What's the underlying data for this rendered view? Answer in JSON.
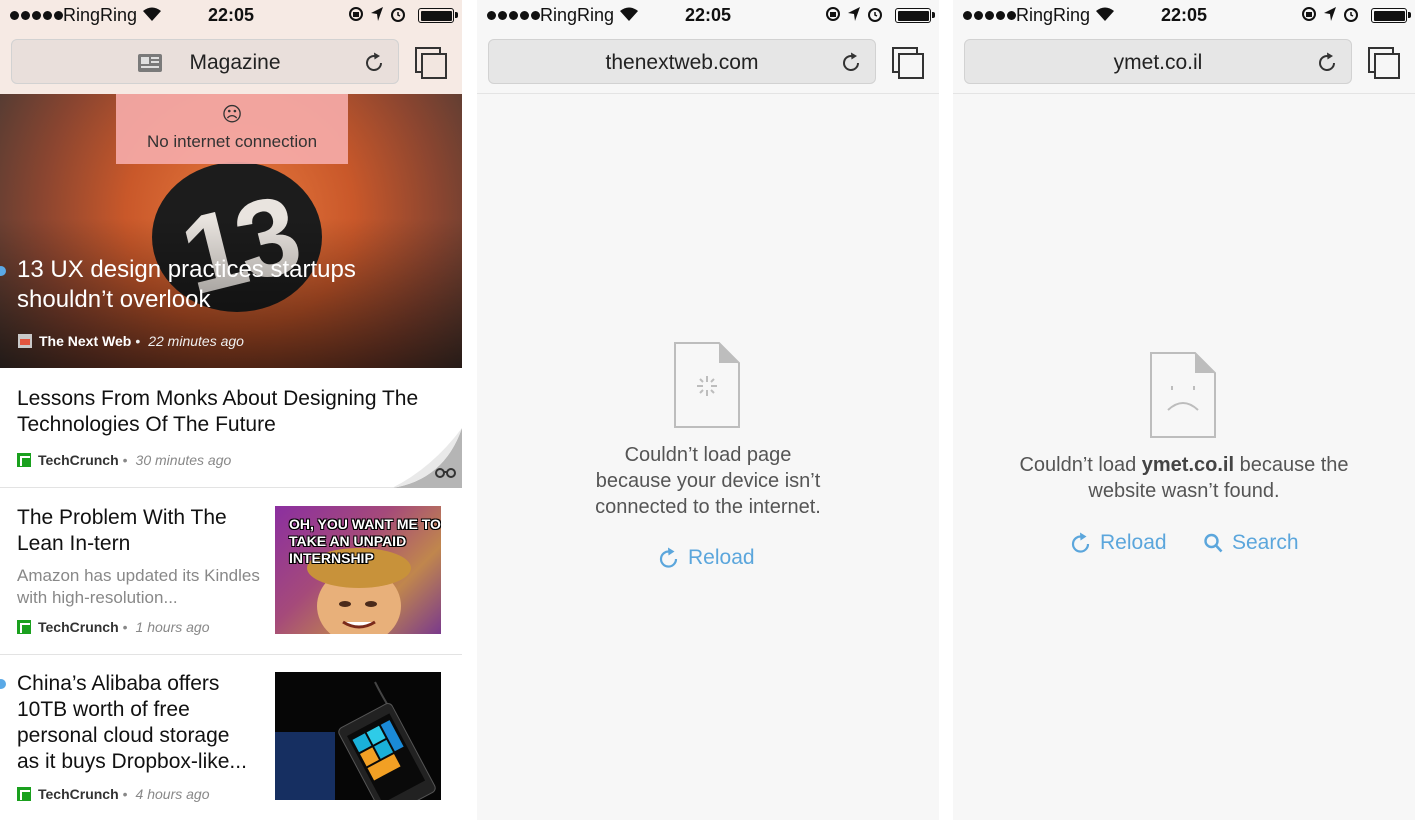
{
  "status_bar": {
    "carrier": "RingRing",
    "time": "22:05"
  },
  "screens": [
    {
      "address": "Magazine",
      "notice": {
        "face": "☹",
        "text": "No internet connection"
      },
      "featured": {
        "image_text": "13",
        "title": "13 UX design practices startups shouldn’t overlook",
        "source": "The Next Web",
        "time": "22 minutes ago"
      },
      "articles": [
        {
          "title": "Lessons From Monks About Designing The Technologies Of The Future",
          "source": "TechCrunch",
          "time": "30 minutes ago"
        },
        {
          "title": "The Problem With The Lean In-tern",
          "description": "Amazon has updated its Kindles with high-resolution...",
          "source": "TechCrunch",
          "time": "1 hours ago",
          "thumb_caption": "OH, YOU WANT ME TO TAKE AN UNPAID INTERNSHIP"
        },
        {
          "title": "China’s Alibaba offers 10TB worth of free personal cloud storage as it buys Dropbox-like...",
          "source": "TechCrunch",
          "time": "4 hours ago"
        }
      ]
    },
    {
      "address": "thenextweb.com",
      "message": "Couldn’t load page because your device isn’t connected to the internet.",
      "reload_label": "Reload"
    },
    {
      "address": "ymet.co.il",
      "message_before": "Couldn’t load ",
      "message_domain": "ymet.co.il",
      "message_after": " because the website wasn’t found.",
      "reload_label": "Reload",
      "search_label": "Search"
    }
  ],
  "colors": {
    "accent": "#5ba6dc",
    "unread_dot": "#5aa9e6",
    "alert_bg": "#f5aaa8",
    "techcrunch_green": "#1aa01e"
  },
  "icons": [
    "signal-dots",
    "wifi-icon",
    "rotation-lock-icon",
    "location-arrow-icon",
    "alarm-icon",
    "battery-icon",
    "reload-icon",
    "tabs-icon",
    "reading-glasses-icon",
    "search-icon",
    "document-error-icon"
  ]
}
